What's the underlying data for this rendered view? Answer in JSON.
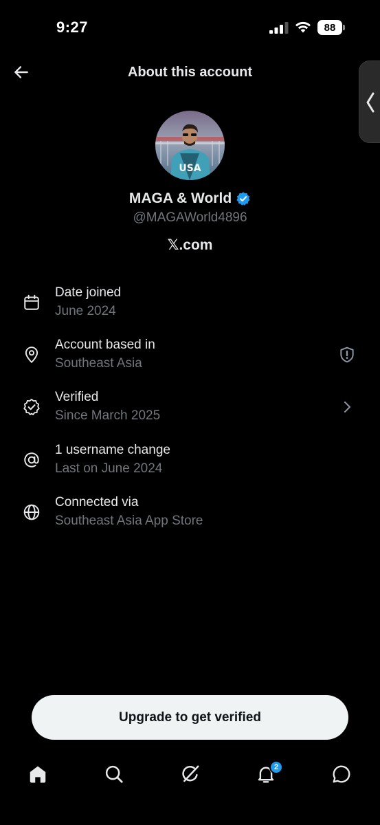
{
  "status_bar": {
    "time": "9:27",
    "battery": "88",
    "icons": [
      "cellular-signal-icon",
      "wifi-icon",
      "battery-icon"
    ]
  },
  "header": {
    "title": "About this account",
    "back_icon": "arrow-left-icon"
  },
  "profile": {
    "name": "MAGA & World",
    "handle": "@MAGAWorld4896",
    "site": "𝕏.com",
    "verified": true,
    "verified_color": "#1d9bf0"
  },
  "info_items": [
    {
      "icon": "calendar-icon",
      "title": "Date joined",
      "subtitle": "June 2024"
    },
    {
      "icon": "location-pin-icon",
      "title": "Account based in",
      "subtitle": "Southeast Asia",
      "trailing_icon": "shield-alert-icon"
    },
    {
      "icon": "verified-badge-icon",
      "title": "Verified",
      "subtitle": "Since March 2025",
      "trailing_icon": "chevron-right-icon"
    },
    {
      "icon": "at-sign-icon",
      "title": "1 username change",
      "subtitle": "Last on June 2024"
    },
    {
      "icon": "globe-icon",
      "title": "Connected via",
      "subtitle": "Southeast Asia App Store"
    }
  ],
  "upgrade_button": {
    "label": "Upgrade to get verified"
  },
  "bottom_nav": {
    "items": [
      "home-icon",
      "search-icon",
      "grok-icon",
      "notifications-icon",
      "messages-icon"
    ],
    "notifications_badge": "2"
  },
  "colors": {
    "background": "#000000",
    "primary_text": "#e7e9ea",
    "secondary_text": "#71767b",
    "accent": "#1d9bf0"
  }
}
